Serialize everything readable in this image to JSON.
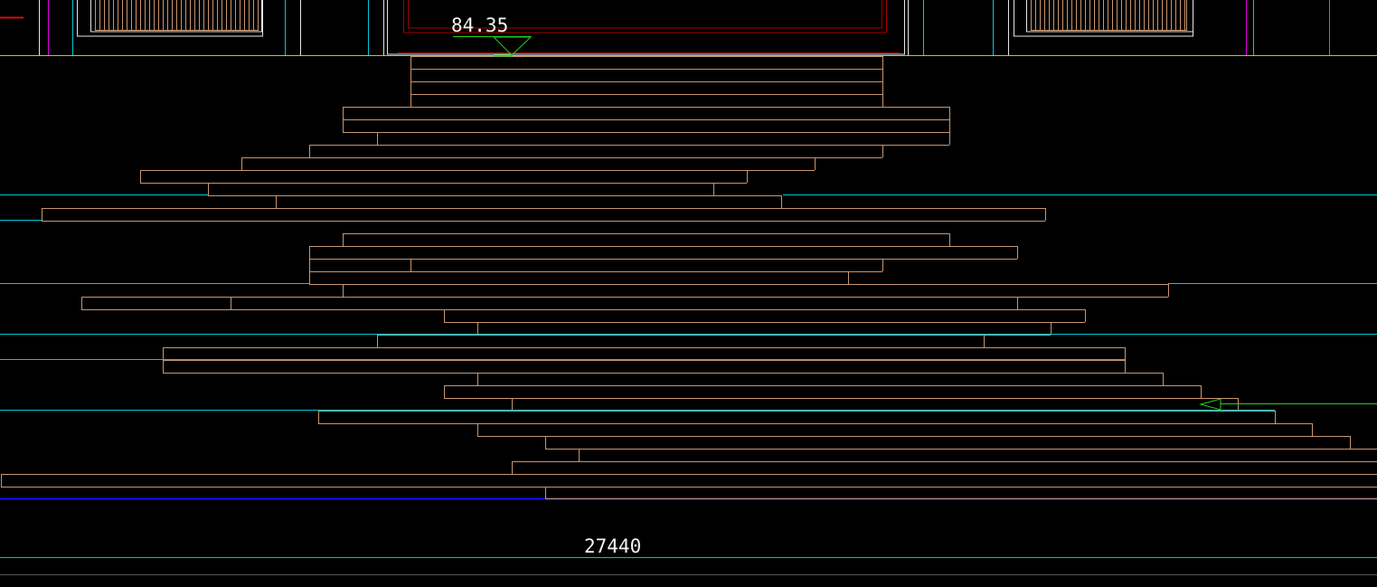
{
  "elevation_label": "84.35",
  "dimension_label": "27440",
  "colors": {
    "background": "#000000",
    "stone_lines": "#c8956e",
    "cyan": "#00c8d8",
    "blue": "#1010ff",
    "green": "#1fd11f",
    "yellow": "#c8c800",
    "red": "#a00000",
    "magenta": "#e000e0",
    "white": "#e6e6e6",
    "grey": "#7a7a7a"
  },
  "icons": [
    "elevation-marker-icon",
    "arrow-left-icon"
  ]
}
